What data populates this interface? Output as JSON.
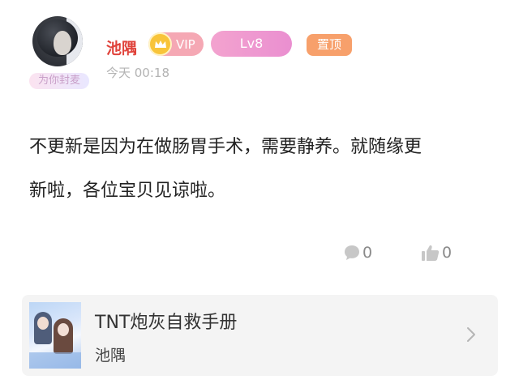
{
  "post": {
    "author": {
      "name": "池隅",
      "frame_tag": "为你封麦",
      "vip_label": "VIP",
      "level": "Lv8"
    },
    "pinned_label": "置顶",
    "timestamp": "今天 00:18",
    "content_line1": "不更新是因为在做肠胃手术，需要静养。就随缘更",
    "content_line2": "新啦，各位宝贝见谅啦。",
    "comment_count": "0",
    "like_count": "0"
  },
  "book_card": {
    "title": "TNT炮灰自救手册",
    "author": "池隅"
  },
  "icons": {
    "vip": "crown-icon",
    "comment": "comment-bubble-icon",
    "like": "thumbs-up-icon",
    "card_arrow": "chevron-right-icon"
  },
  "colors": {
    "username": "#e0433b",
    "vip_badge": "#f5a8b4",
    "level_badge": "#ea8fd0",
    "pinned_badge": "#f7a06b",
    "timestamp": "#b3b3b3",
    "card_bg": "#f4f4f4"
  }
}
